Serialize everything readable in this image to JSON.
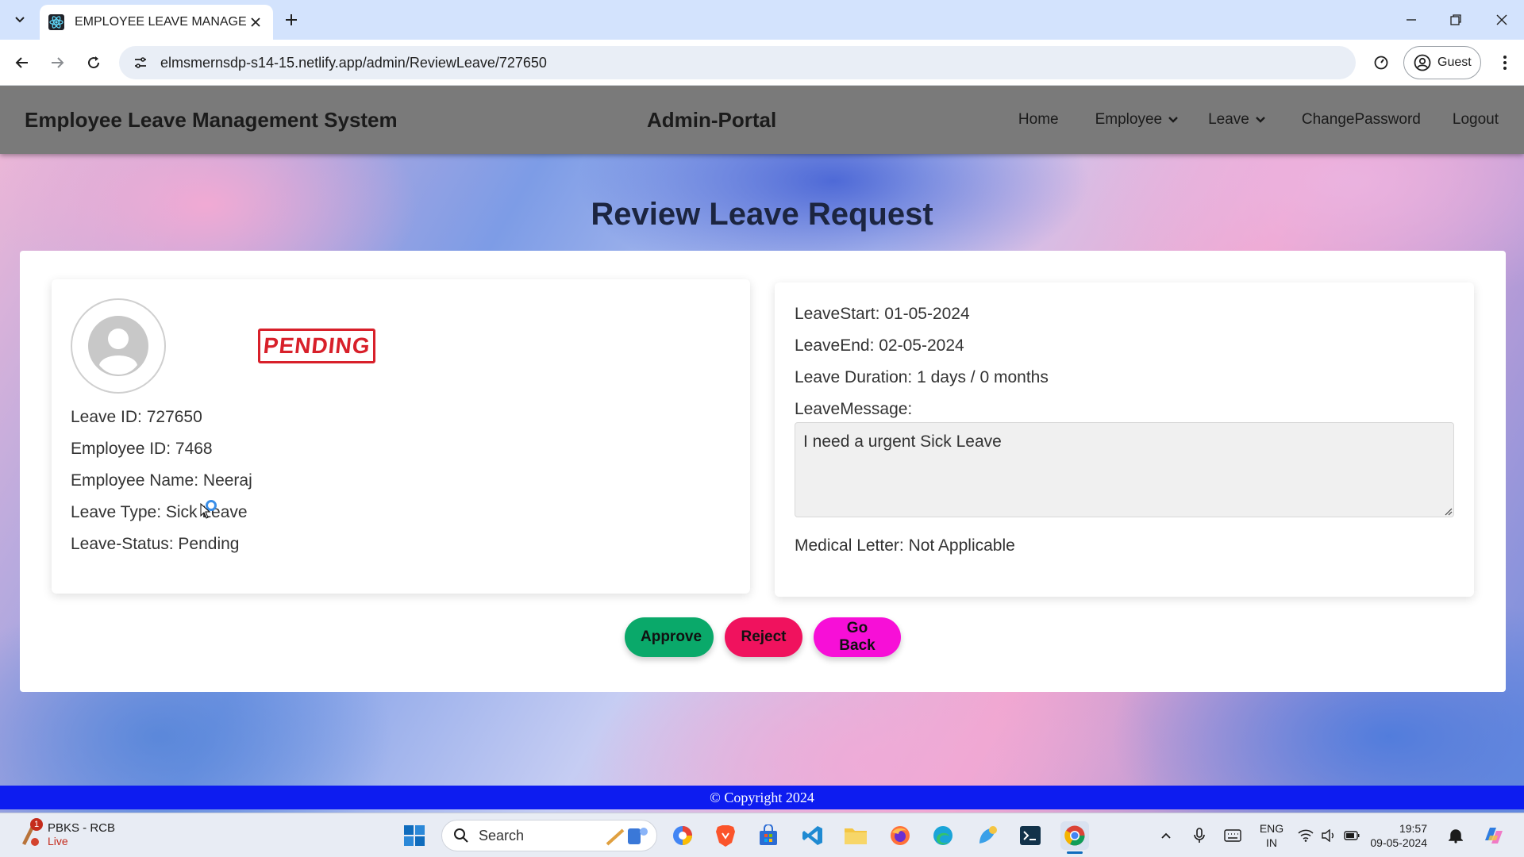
{
  "browser": {
    "tab_title": "EMPLOYEE LEAVE MANAGEMEN",
    "url": "elmsmernsdp-s14-15.netlify.app/admin/ReviewLeave/727650",
    "profile_label": "Guest"
  },
  "navbar": {
    "brand": "Employee Leave Management System",
    "portal": "Admin-Portal",
    "links": {
      "home": "Home",
      "employee": "Employee",
      "leave": "Leave",
      "change_password": "ChangePassword",
      "logout": "Logout"
    }
  },
  "page": {
    "heading": "Review Leave Request"
  },
  "left_card": {
    "stamp": "PENDING",
    "leave_id": "Leave ID: 727650",
    "employee_id": "Employee ID: 7468",
    "employee_name": "Employee Name: Neeraj",
    "leave_type": "Leave Type: Sick Leave",
    "leave_status": "Leave-Status: Pending"
  },
  "right_card": {
    "leave_start": "LeaveStart: 01-05-2024",
    "leave_end": "LeaveEnd: 02-05-2024",
    "leave_duration": "Leave Duration: 1 days / 0 months",
    "leave_message_label": "LeaveMessage:",
    "leave_message": "I need a urgent Sick Leave",
    "medical_letter": "Medical Letter: Not Applicable"
  },
  "actions": {
    "approve": "Approve",
    "reject": "Reject",
    "go_back": "Go Back"
  },
  "footer": {
    "copyright": "© Copyright 2024"
  },
  "taskbar": {
    "news_badge": "1",
    "news_title": "PBKS - RCB",
    "news_sub": "Live",
    "search_label": "Search",
    "lang_top": "ENG",
    "lang_bottom": "IN",
    "time": "19:57",
    "date": "09-05-2024"
  },
  "colors": {
    "navbar": "#7a7a7a",
    "approve": "#0aa96a",
    "reject": "#f0125e",
    "go_back": "#f70fd7",
    "footer": "#0d1cf0",
    "stamp": "#d8202a"
  }
}
